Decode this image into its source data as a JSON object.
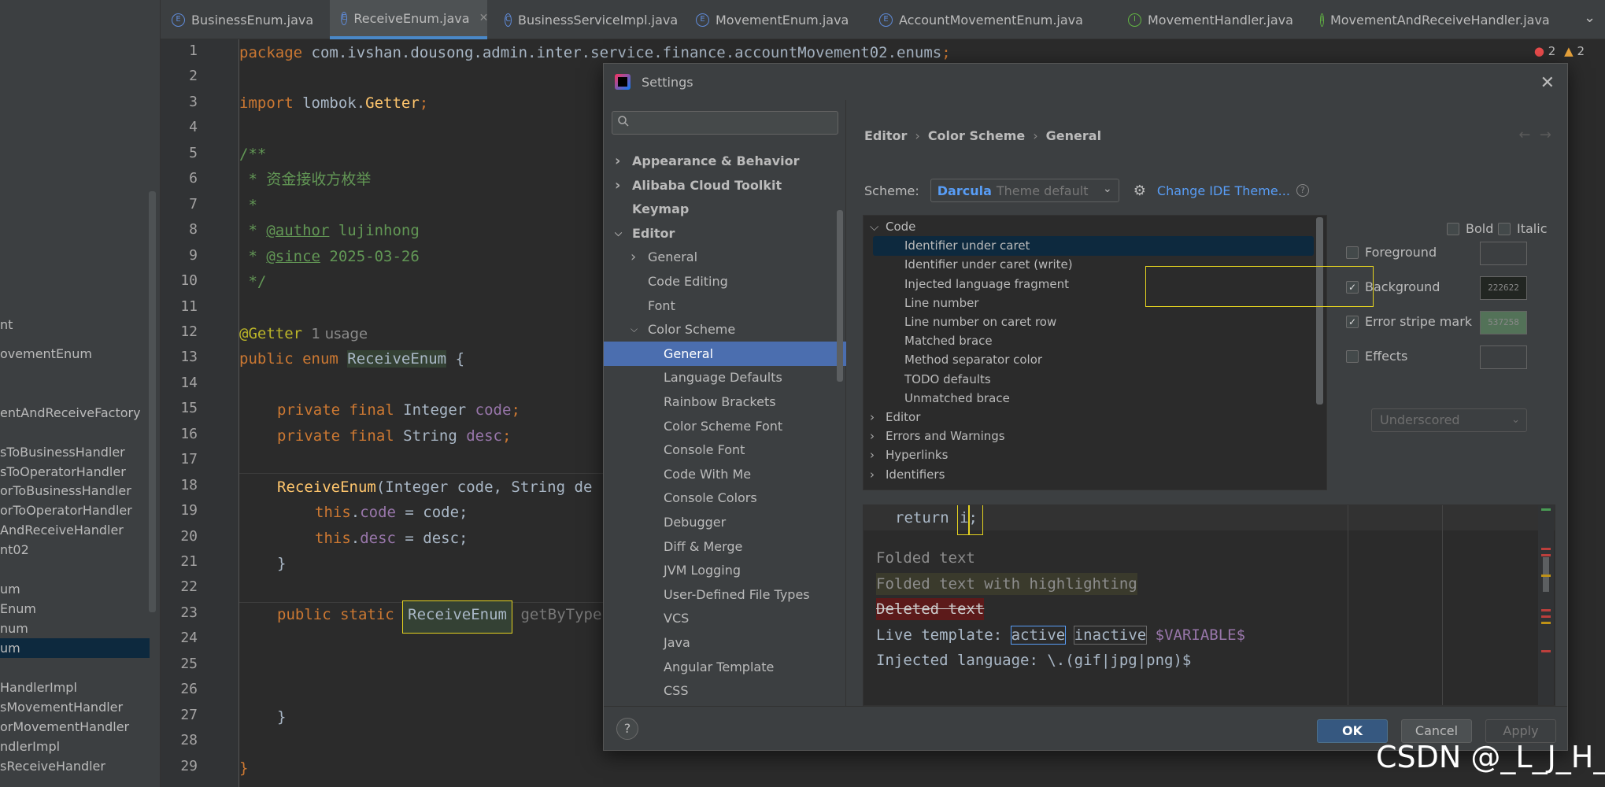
{
  "tabs": [
    {
      "icon": "E",
      "kind": "enum",
      "label": "BusinessEnum.java"
    },
    {
      "icon": "E",
      "kind": "enum",
      "label": "ReceiveEnum.java",
      "active": true
    },
    {
      "icon": "C",
      "kind": "class",
      "label": "BusinessServiceImpl.java"
    },
    {
      "icon": "E",
      "kind": "enum",
      "label": "MovementEnum.java"
    },
    {
      "icon": "E",
      "kind": "enum",
      "label": "AccountMovementEnum.java"
    },
    {
      "icon": "I",
      "kind": "interface",
      "label": "MovementHandler.java"
    },
    {
      "icon": "I",
      "kind": "interface",
      "label": "MovementAndReceiveHandler.java"
    }
  ],
  "project_items": [
    "nt",
    "ovementEnum",
    "",
    "entAndReceiveFactory",
    "",
    "sToBusinessHandler",
    "sToOperatorHandler",
    "orToBusinessHandler",
    "orToOperatorHandler",
    "AndReceiveHandler",
    "nt02",
    "",
    "um",
    "Enum",
    "num",
    "um",
    "",
    "HandlerImpl",
    "sMovementHandler",
    "orMovementHandler",
    "ndlerImpl",
    "sReceiveHandler"
  ],
  "line_numbers": [
    "1",
    "2",
    "3",
    "4",
    "5",
    "6",
    "7",
    "8",
    "9",
    "10",
    "11",
    "12",
    "13",
    "14",
    "15",
    "16",
    "17",
    "18",
    "19",
    "20",
    "21",
    "22",
    "23",
    "24",
    "25",
    "26",
    "27",
    "28",
    "29"
  ],
  "code": {
    "l1_kw": "package",
    "l1_pkg": " com.ivshan.dousong.admin.inter.service.finance.accountMovement02.enums",
    "l1_semi": ";",
    "l3_kw": "import",
    "l3_pkg": " lombok.",
    "l3_cls": "Getter",
    "l3_semi": ";",
    "l5": "/**",
    "l6": " * 资金接收方枚举",
    "l7": " *",
    "l8_pre": " * ",
    "l8_tag": "@author",
    "l8_val": " lujinhong",
    "l9_pre": " * ",
    "l9_tag": "@since",
    "l9_val": " 2025-03-26",
    "l10": " */",
    "l12_an": "@Getter",
    "l12_hint": "  1 usage",
    "l13_kw": "public enum ",
    "l13_name": "ReceiveEnum",
    "l13_brace": " {",
    "l15_kw": "private final ",
    "l15_type": "Integer ",
    "l15_fld": "code",
    "l15_semi": ";",
    "l16_kw": "private final ",
    "l16_type": "String ",
    "l16_fld": "desc",
    "l16_semi": ";",
    "l18_fn": "ReceiveEnum",
    "l18_rest": "(Integer code, String de",
    "l19_kw": "this",
    "l19_dot": ".",
    "l19_fld": "code",
    "l19_rest": " = code;",
    "l20_kw": "this",
    "l20_dot": ".",
    "l20_fld": "desc",
    "l20_rest": " = desc;",
    "l21": "}",
    "l23_kw": "public static ",
    "l23_name": "ReceiveEnum",
    "l23_rest": " getByType",
    "l26": "}",
    "l28": "}"
  },
  "status": {
    "errors": "2",
    "warnings": "2"
  },
  "dialog": {
    "title": "Settings",
    "search_placeholder": "",
    "tree": [
      {
        "label": "Appearance & Behavior",
        "level": 0,
        "bold": true,
        "arrow": "right"
      },
      {
        "label": "Alibaba Cloud Toolkit",
        "level": 0,
        "bold": true,
        "arrow": "right"
      },
      {
        "label": "Keymap",
        "level": 0,
        "bold": true,
        "arrow": ""
      },
      {
        "label": "Editor",
        "level": 0,
        "bold": true,
        "arrow": "down"
      },
      {
        "label": "General",
        "level": 1,
        "arrow": "right"
      },
      {
        "label": "Code Editing",
        "level": 1,
        "arrow": ""
      },
      {
        "label": "Font",
        "level": 1,
        "arrow": ""
      },
      {
        "label": "Color Scheme",
        "level": 1,
        "arrow": "down"
      },
      {
        "label": "General",
        "level": 2,
        "arrow": "",
        "selected": true
      },
      {
        "label": "Language Defaults",
        "level": 2,
        "arrow": ""
      },
      {
        "label": "Rainbow Brackets",
        "level": 2,
        "arrow": ""
      },
      {
        "label": "Color Scheme Font",
        "level": 2,
        "arrow": ""
      },
      {
        "label": "Console Font",
        "level": 2,
        "arrow": ""
      },
      {
        "label": "Code With Me",
        "level": 2,
        "arrow": ""
      },
      {
        "label": "Console Colors",
        "level": 2,
        "arrow": ""
      },
      {
        "label": "Debugger",
        "level": 2,
        "arrow": ""
      },
      {
        "label": "Diff & Merge",
        "level": 2,
        "arrow": ""
      },
      {
        "label": "JVM Logging",
        "level": 2,
        "arrow": ""
      },
      {
        "label": "User-Defined File Types",
        "level": 2,
        "arrow": ""
      },
      {
        "label": "VCS",
        "level": 2,
        "arrow": ""
      },
      {
        "label": "Java",
        "level": 2,
        "arrow": ""
      },
      {
        "label": "Angular Template",
        "level": 2,
        "arrow": ""
      },
      {
        "label": "CSS",
        "level": 2,
        "arrow": ""
      }
    ],
    "breadcrumb": [
      "Editor",
      "Color Scheme",
      "General"
    ],
    "scheme_label": "Scheme:",
    "scheme_value": "Darcula",
    "scheme_hint": "Theme default",
    "change_theme": "Change IDE Theme...",
    "code_tree": [
      {
        "label": "Code",
        "level": 0,
        "arrow": "down"
      },
      {
        "label": "Identifier under caret",
        "level": 1,
        "selected": true
      },
      {
        "label": "Identifier under caret (write)",
        "level": 1
      },
      {
        "label": "Injected language fragment",
        "level": 1
      },
      {
        "label": "Line number",
        "level": 1
      },
      {
        "label": "Line number on caret row",
        "level": 1
      },
      {
        "label": "Matched brace",
        "level": 1
      },
      {
        "label": "Method separator color",
        "level": 1
      },
      {
        "label": "TODO defaults",
        "level": 1
      },
      {
        "label": "Unmatched brace",
        "level": 1
      },
      {
        "label": "Editor",
        "level": 0,
        "arrow": "right"
      },
      {
        "label": "Errors and Warnings",
        "level": 0,
        "arrow": "right"
      },
      {
        "label": "Hyperlinks",
        "level": 0,
        "arrow": "right"
      },
      {
        "label": "Identifiers",
        "level": 0,
        "arrow": "right"
      }
    ],
    "attrs": {
      "bold": "Bold",
      "italic": "Italic",
      "foreground": "Foreground",
      "background": "Background",
      "background_value": "222622",
      "background_color": "#222622",
      "error_stripe": "Error stripe mark",
      "error_stripe_value": "537258",
      "error_stripe_color": "#537258",
      "effects": "Effects",
      "effects_type": "Underscored"
    },
    "preview": {
      "return_kw": "return ",
      "return_id": "i",
      "return_semi": ";",
      "folded": "Folded text",
      "folded_hl": "Folded text with highlighting",
      "deleted": "Deleted text",
      "live_label": "Live template: ",
      "live_active": "active",
      "live_inactive": "inactive",
      "live_var": "$VARIABLE$",
      "injected": "Injected language: \\.(gif|jpg|png)$"
    },
    "buttons": {
      "ok": "OK",
      "cancel": "Cancel",
      "apply": "Apply",
      "help": "?"
    }
  },
  "watermark": "CSDN @_L_J_H_"
}
